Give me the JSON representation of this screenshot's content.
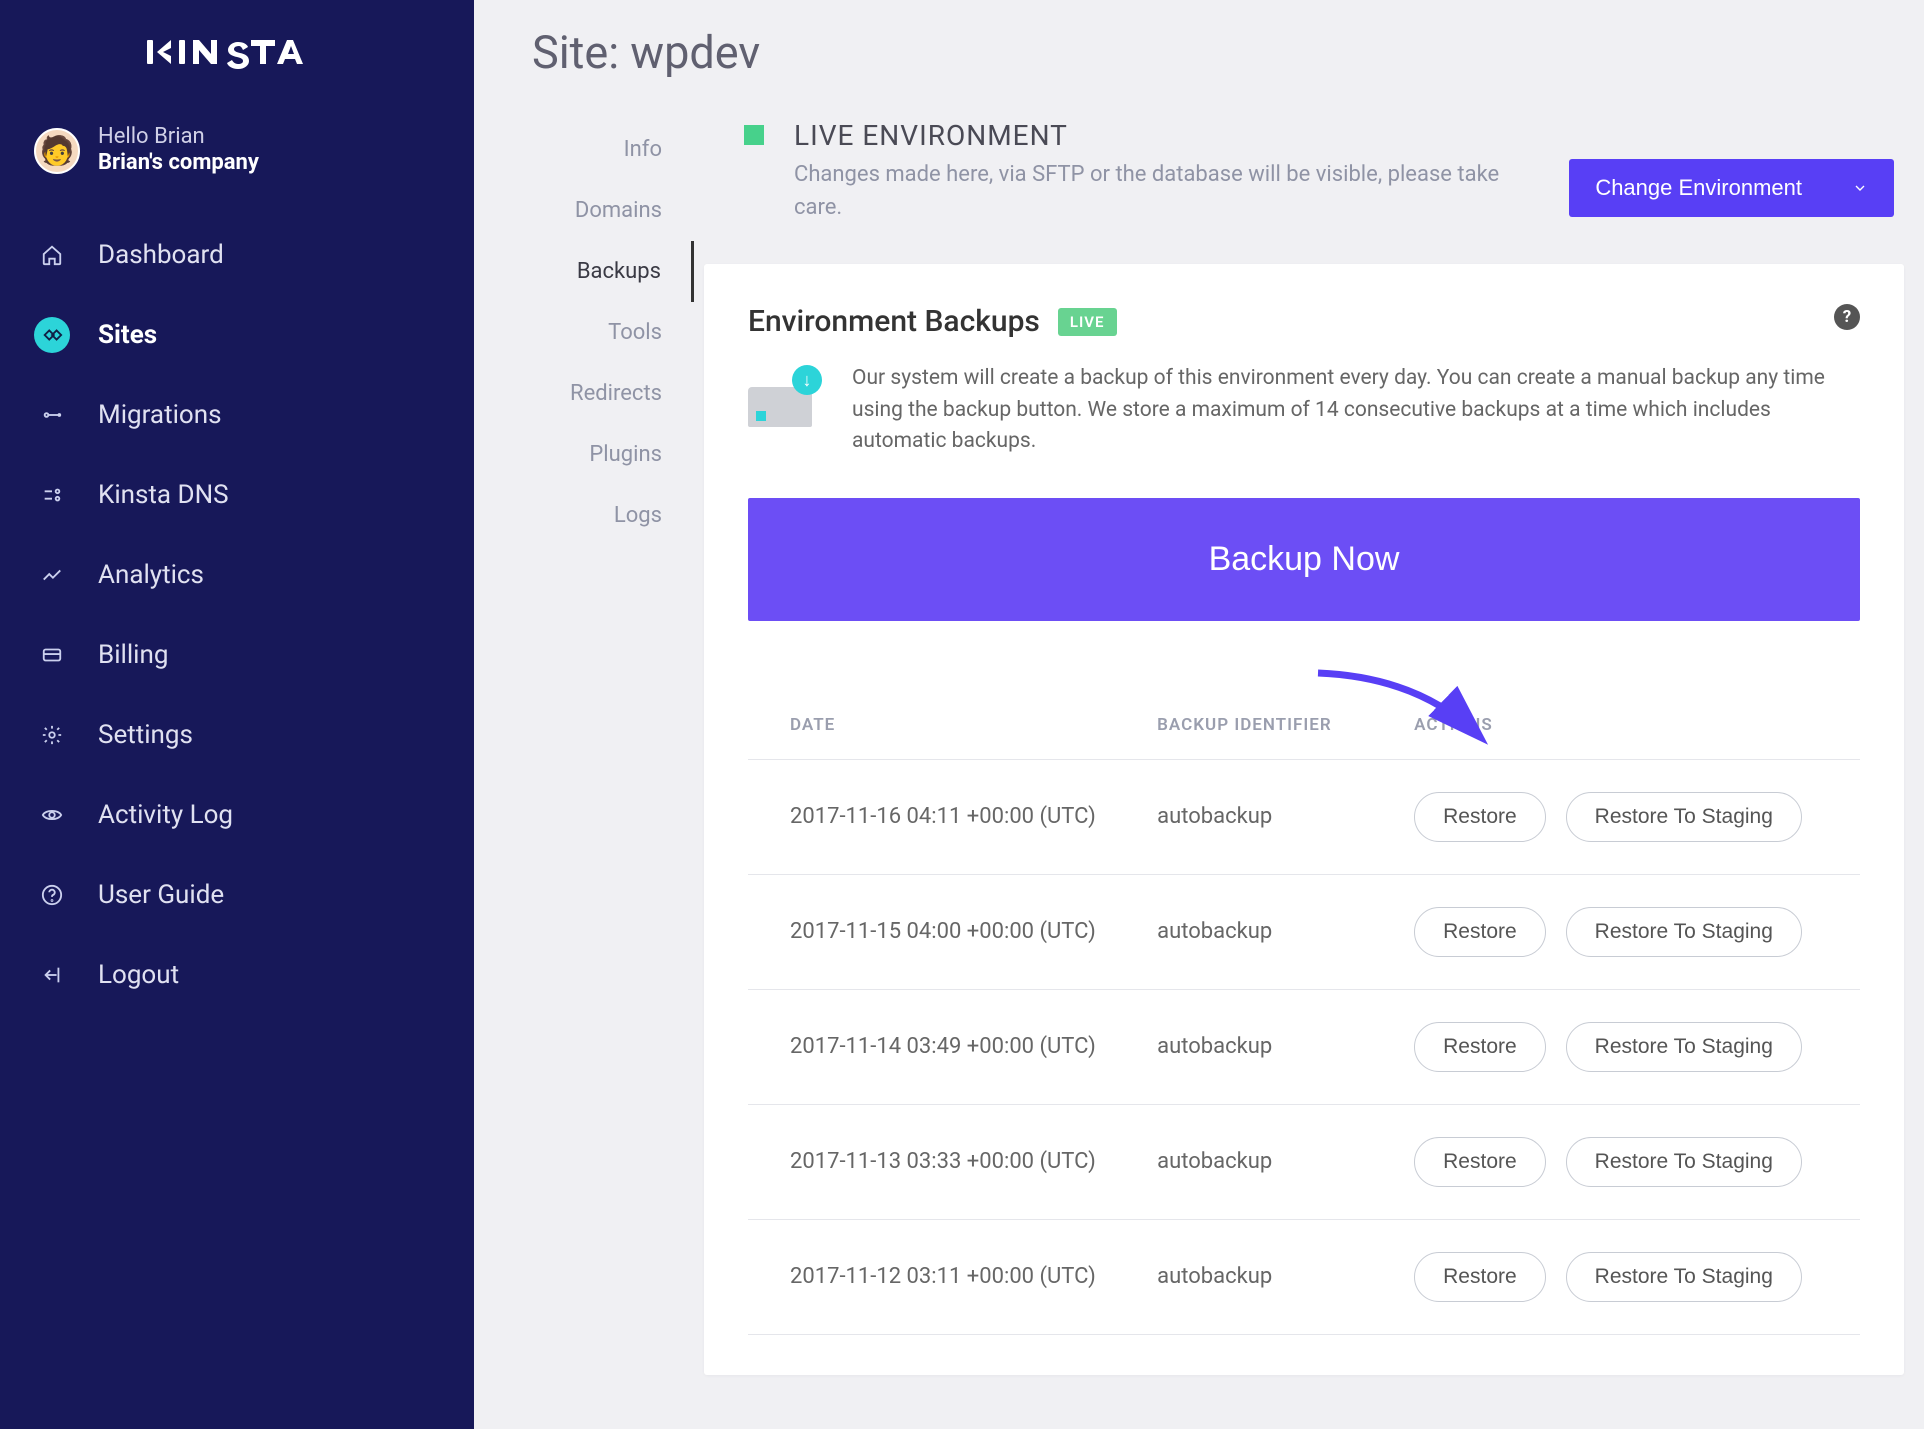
{
  "brand": "KINSTA",
  "user": {
    "greeting": "Hello Brian",
    "company": "Brian's company"
  },
  "nav": {
    "items": [
      {
        "label": "Dashboard",
        "icon": "home"
      },
      {
        "label": "Sites",
        "icon": "sites",
        "active": true
      },
      {
        "label": "Migrations",
        "icon": "migrations"
      },
      {
        "label": "Kinsta DNS",
        "icon": "dns"
      },
      {
        "label": "Analytics",
        "icon": "analytics"
      },
      {
        "label": "Billing",
        "icon": "billing"
      },
      {
        "label": "Settings",
        "icon": "settings"
      },
      {
        "label": "Activity Log",
        "icon": "activity"
      },
      {
        "label": "User Guide",
        "icon": "guide"
      },
      {
        "label": "Logout",
        "icon": "logout"
      }
    ]
  },
  "page": {
    "title": "Site: wpdev"
  },
  "subnav": {
    "items": [
      {
        "label": "Info"
      },
      {
        "label": "Domains"
      },
      {
        "label": "Backups",
        "active": true
      },
      {
        "label": "Tools"
      },
      {
        "label": "Redirects"
      },
      {
        "label": "Plugins"
      },
      {
        "label": "Logs"
      }
    ]
  },
  "env": {
    "title": "LIVE ENVIRONMENT",
    "desc": "Changes made here, via SFTP or the database will be visible, please take care.",
    "change_label": "Change Environment"
  },
  "card": {
    "title": "Environment Backups",
    "badge": "LIVE",
    "desc": "Our system will create a backup of this environment every day. You can create a manual backup any time using the backup button. We store a maximum of 14 consecutive backups at a time which includes automatic backups.",
    "backup_now": "Backup Now",
    "help": "?"
  },
  "table": {
    "head": {
      "date": "DATE",
      "ident": "BACKUP IDENTIFIER",
      "actions": "ACTIONS"
    },
    "restore_label": "Restore",
    "restore_staging_label": "Restore To Staging",
    "rows": [
      {
        "date": "2017-11-16 04:11 +00:00 (UTC)",
        "ident": "autobackup"
      },
      {
        "date": "2017-11-15 04:00 +00:00 (UTC)",
        "ident": "autobackup"
      },
      {
        "date": "2017-11-14 03:49 +00:00 (UTC)",
        "ident": "autobackup"
      },
      {
        "date": "2017-11-13 03:33 +00:00 (UTC)",
        "ident": "autobackup"
      },
      {
        "date": "2017-11-12 03:11 +00:00 (UTC)",
        "ident": "autobackup"
      }
    ]
  }
}
